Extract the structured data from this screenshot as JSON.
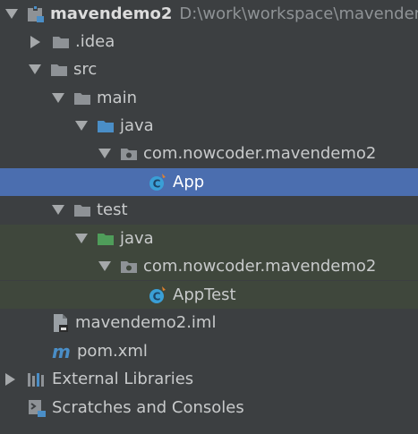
{
  "colors": {
    "panel_bg": "#3c3f41",
    "selection": "#4b6eaf",
    "test_scope_bg": "#3f473c",
    "text": "#c8cacb",
    "path_text": "#8f9396",
    "folder_gray": "#8e9296",
    "source_folder_blue": "#4a8ec7",
    "test_folder_green": "#4f9d5a",
    "class_icon": "#3a9fd6"
  },
  "tree": {
    "project": {
      "name": "mavendemo2",
      "path": "D:\\work\\workspace\\mavendemo",
      "icon": "module-icon",
      "expanded": true
    },
    "idea": {
      "name": ".idea",
      "icon": "folder-icon",
      "expanded": false
    },
    "src": {
      "name": "src",
      "icon": "folder-icon",
      "expanded": true
    },
    "main": {
      "name": "main",
      "icon": "folder-icon",
      "expanded": true
    },
    "main_java": {
      "name": "java",
      "icon": "source-folder-icon",
      "expanded": true
    },
    "main_package": {
      "name": "com.nowcoder.mavendemo2",
      "icon": "package-icon",
      "expanded": true
    },
    "app": {
      "name": "App",
      "icon": "java-class-icon",
      "selected": true
    },
    "test": {
      "name": "test",
      "icon": "folder-icon",
      "expanded": true
    },
    "test_java": {
      "name": "java",
      "icon": "test-source-folder-icon",
      "expanded": true
    },
    "test_package": {
      "name": "com.nowcoder.mavendemo2",
      "icon": "package-icon",
      "expanded": true
    },
    "apptest": {
      "name": "AppTest",
      "icon": "java-class-icon"
    },
    "iml": {
      "name": "mavendemo2.iml",
      "icon": "iml-file-icon"
    },
    "pom": {
      "name": "pom.xml",
      "icon": "maven-icon"
    },
    "libraries": {
      "name": "External Libraries",
      "icon": "libraries-icon",
      "expanded": false
    },
    "scratches": {
      "name": "Scratches and Consoles",
      "icon": "scratches-icon"
    }
  }
}
